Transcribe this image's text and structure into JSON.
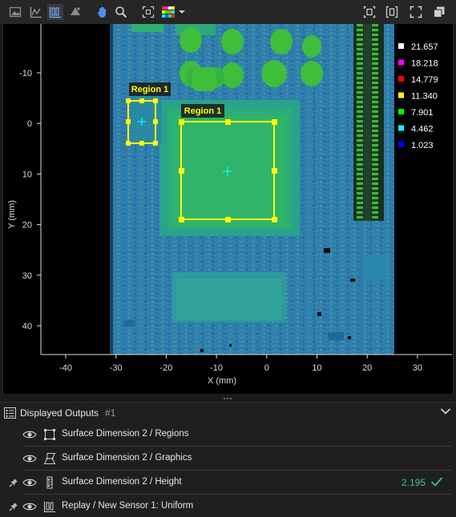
{
  "toolbar": {
    "icons": [
      "image-view-icon",
      "profile-view-icon",
      "height-map-view-icon",
      "3d-view-icon",
      "pan-hand-icon",
      "zoom-icon",
      "fit-view-icon",
      "color-palette-icon",
      "dropdown-arrow-icon",
      "snapshot-icon",
      "split-view-icon",
      "fullscreen-icon",
      "window-copy-icon"
    ]
  },
  "viewer": {
    "x_axis_label": "X (mm)",
    "y_axis_label": "Y (mm)",
    "x_ticks": [
      "-40",
      "-30",
      "-20",
      "-10",
      "0",
      "10",
      "20",
      "30"
    ],
    "y_ticks": [
      "-10",
      "0",
      "10",
      "20",
      "30",
      "40"
    ],
    "legend": [
      {
        "value": "21.657",
        "color": "#ffffff"
      },
      {
        "value": "18.218",
        "color": "#ff00ff"
      },
      {
        "value": "14.779",
        "color": "#ff0000"
      },
      {
        "value": "11.340",
        "color": "#ffff00"
      },
      {
        "value": "7.901",
        "color": "#00ff00"
      },
      {
        "value": "4.462",
        "color": "#00ffff"
      },
      {
        "value": "1.023",
        "color": "#0000ff"
      }
    ],
    "regions": [
      {
        "label": "Region 1"
      },
      {
        "label": "Region 1"
      }
    ],
    "region_color": "#ffff00"
  },
  "outputs": {
    "title": "Displayed Outputs",
    "count": "#1",
    "rows": [
      {
        "icon": "region-icon",
        "label": "Surface Dimension 2 / Regions",
        "value": "",
        "pinned": false
      },
      {
        "icon": "graphics-icon",
        "label": "Surface Dimension 2 / Graphics",
        "value": "",
        "pinned": false
      },
      {
        "icon": "height-measurement-icon",
        "label": "Surface Dimension 2 / Height",
        "value": "2.195",
        "pinned": true,
        "pass": true
      },
      {
        "icon": "sensor-data-icon",
        "label": "Replay / New Sensor 1: Uniform",
        "value": "",
        "pinned": true
      }
    ],
    "value_color": "#37c0a5"
  }
}
